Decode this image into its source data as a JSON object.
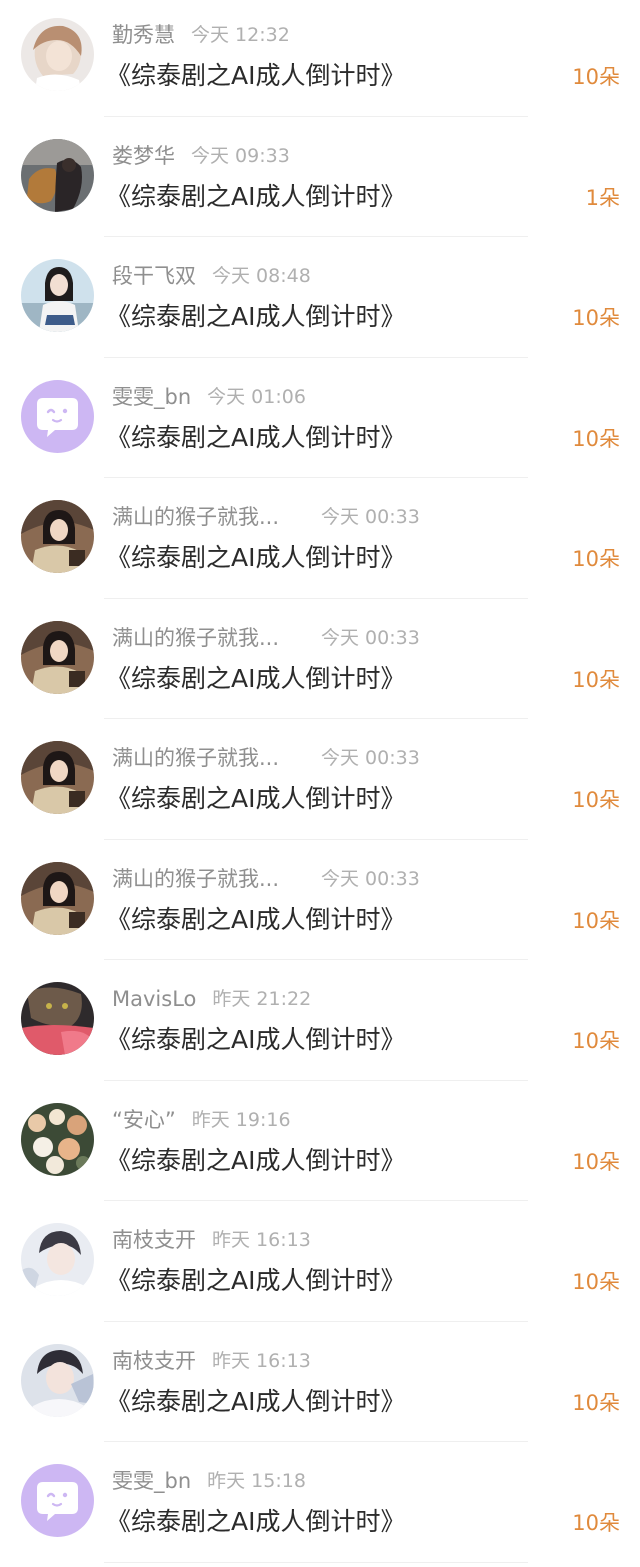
{
  "colors": {
    "name": "#8f8f8f",
    "time": "#b0b0b0",
    "title": "#2b2b2b",
    "gift": "#e08a3c",
    "divider": "#efefef",
    "default_avatar": "#cdb7f3"
  },
  "items": [
    {
      "name": "勤秀慧",
      "time": "今天 12:32",
      "title": "《综泰剧之AI成人倒计时》",
      "gift": "10朵",
      "avatar": "photo-avatar-icon"
    },
    {
      "name": "娄梦华",
      "time": "今天 09:33",
      "title": "《综泰剧之AI成人倒计时》",
      "gift": "1朵",
      "avatar": "photo-avatar-icon"
    },
    {
      "name": "段干飞双",
      "time": "今天 08:48",
      "title": "《综泰剧之AI成人倒计时》",
      "gift": "10朵",
      "avatar": "photo-avatar-icon"
    },
    {
      "name": "雯雯_bn",
      "time": "今天 01:06",
      "title": "《综泰剧之AI成人倒计时》",
      "gift": "10朵",
      "avatar": "default-chat-avatar-icon"
    },
    {
      "name": "满山的猴子就我...",
      "time": "今天 00:33",
      "title": "《综泰剧之AI成人倒计时》",
      "gift": "10朵",
      "avatar": "photo-avatar-icon"
    },
    {
      "name": "满山的猴子就我...",
      "time": "今天 00:33",
      "title": "《综泰剧之AI成人倒计时》",
      "gift": "10朵",
      "avatar": "photo-avatar-icon"
    },
    {
      "name": "满山的猴子就我...",
      "time": "今天 00:33",
      "title": "《综泰剧之AI成人倒计时》",
      "gift": "10朵",
      "avatar": "photo-avatar-icon"
    },
    {
      "name": "满山的猴子就我...",
      "time": "今天 00:33",
      "title": "《综泰剧之AI成人倒计时》",
      "gift": "10朵",
      "avatar": "photo-avatar-icon"
    },
    {
      "name": "MavisLo",
      "time": "昨天 21:22",
      "title": "《综泰剧之AI成人倒计时》",
      "gift": "10朵",
      "avatar": "photo-avatar-icon"
    },
    {
      "name": "“安心”",
      "time": "昨天 19:16",
      "title": "《综泰剧之AI成人倒计时》",
      "gift": "10朵",
      "avatar": "photo-avatar-icon"
    },
    {
      "name": "南枝支开",
      "time": "昨天 16:13",
      "title": "《综泰剧之AI成人倒计时》",
      "gift": "10朵",
      "avatar": "photo-avatar-icon"
    },
    {
      "name": "南枝支开",
      "time": "昨天 16:13",
      "title": "《综泰剧之AI成人倒计时》",
      "gift": "10朵",
      "avatar": "photo-avatar-icon"
    },
    {
      "name": "雯雯_bn",
      "time": "昨天 15:18",
      "title": "《综泰剧之AI成人倒计时》",
      "gift": "10朵",
      "avatar": "default-chat-avatar-icon"
    }
  ]
}
